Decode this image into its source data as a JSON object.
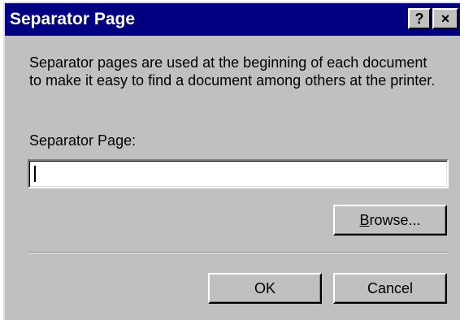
{
  "window": {
    "title": "Separator Page",
    "help_glyph": "?",
    "close_glyph": "×"
  },
  "content": {
    "description": "Separator pages are used at the beginning of each document to make it easy to find a document among others at the printer.",
    "field_label": "Separator Page:",
    "field_value": "",
    "browse_mnemonic": "B",
    "browse_rest": "rowse...",
    "ok_label": "OK",
    "cancel_label": "Cancel"
  },
  "colors": {
    "titlebar": "#000080",
    "face": "#c0c0c0"
  }
}
